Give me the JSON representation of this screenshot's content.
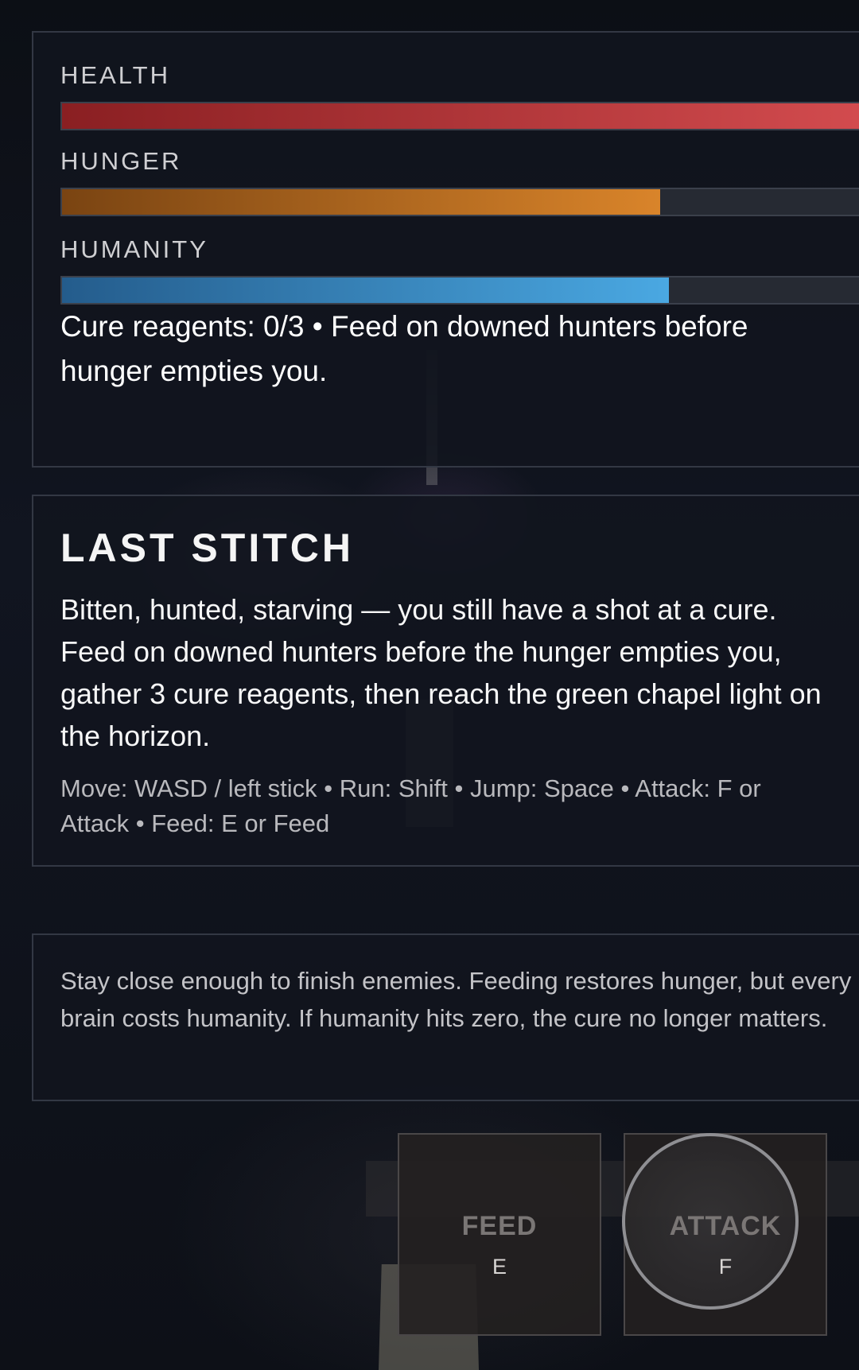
{
  "status": {
    "stats": [
      {
        "label": "HEALTH",
        "fill": 1.0,
        "color": "#c94346"
      },
      {
        "label": "HUNGER",
        "fill": 0.75,
        "color": "#d07d28"
      },
      {
        "label": "HUMANITY",
        "fill": 0.761,
        "color": "#45a2dc"
      }
    ],
    "reagent_line": "Cure reagents: 0/3 • Feed on downed hunters before hunger empties you."
  },
  "intro": {
    "title": "LAST STITCH",
    "body": "Bitten, hunted, starving — you still have a shot at a cure. Feed on downed hunters before the hunger empties you, gather 3 cure reagents, then reach the green chapel light on the horizon.",
    "controls": "Move: WASD / left stick • Run: Shift • Jump: Space • Attack: F or Attack • Feed: E or Feed"
  },
  "hint": {
    "text": "Stay close enough to finish enemies. Feeding restores hunger, but every brain costs humanity. If humanity hits zero, the cure no longer matters."
  },
  "actions": {
    "feed": {
      "label": "FEED",
      "key": "E"
    },
    "attack": {
      "label": "ATTACK",
      "key": "F"
    }
  }
}
